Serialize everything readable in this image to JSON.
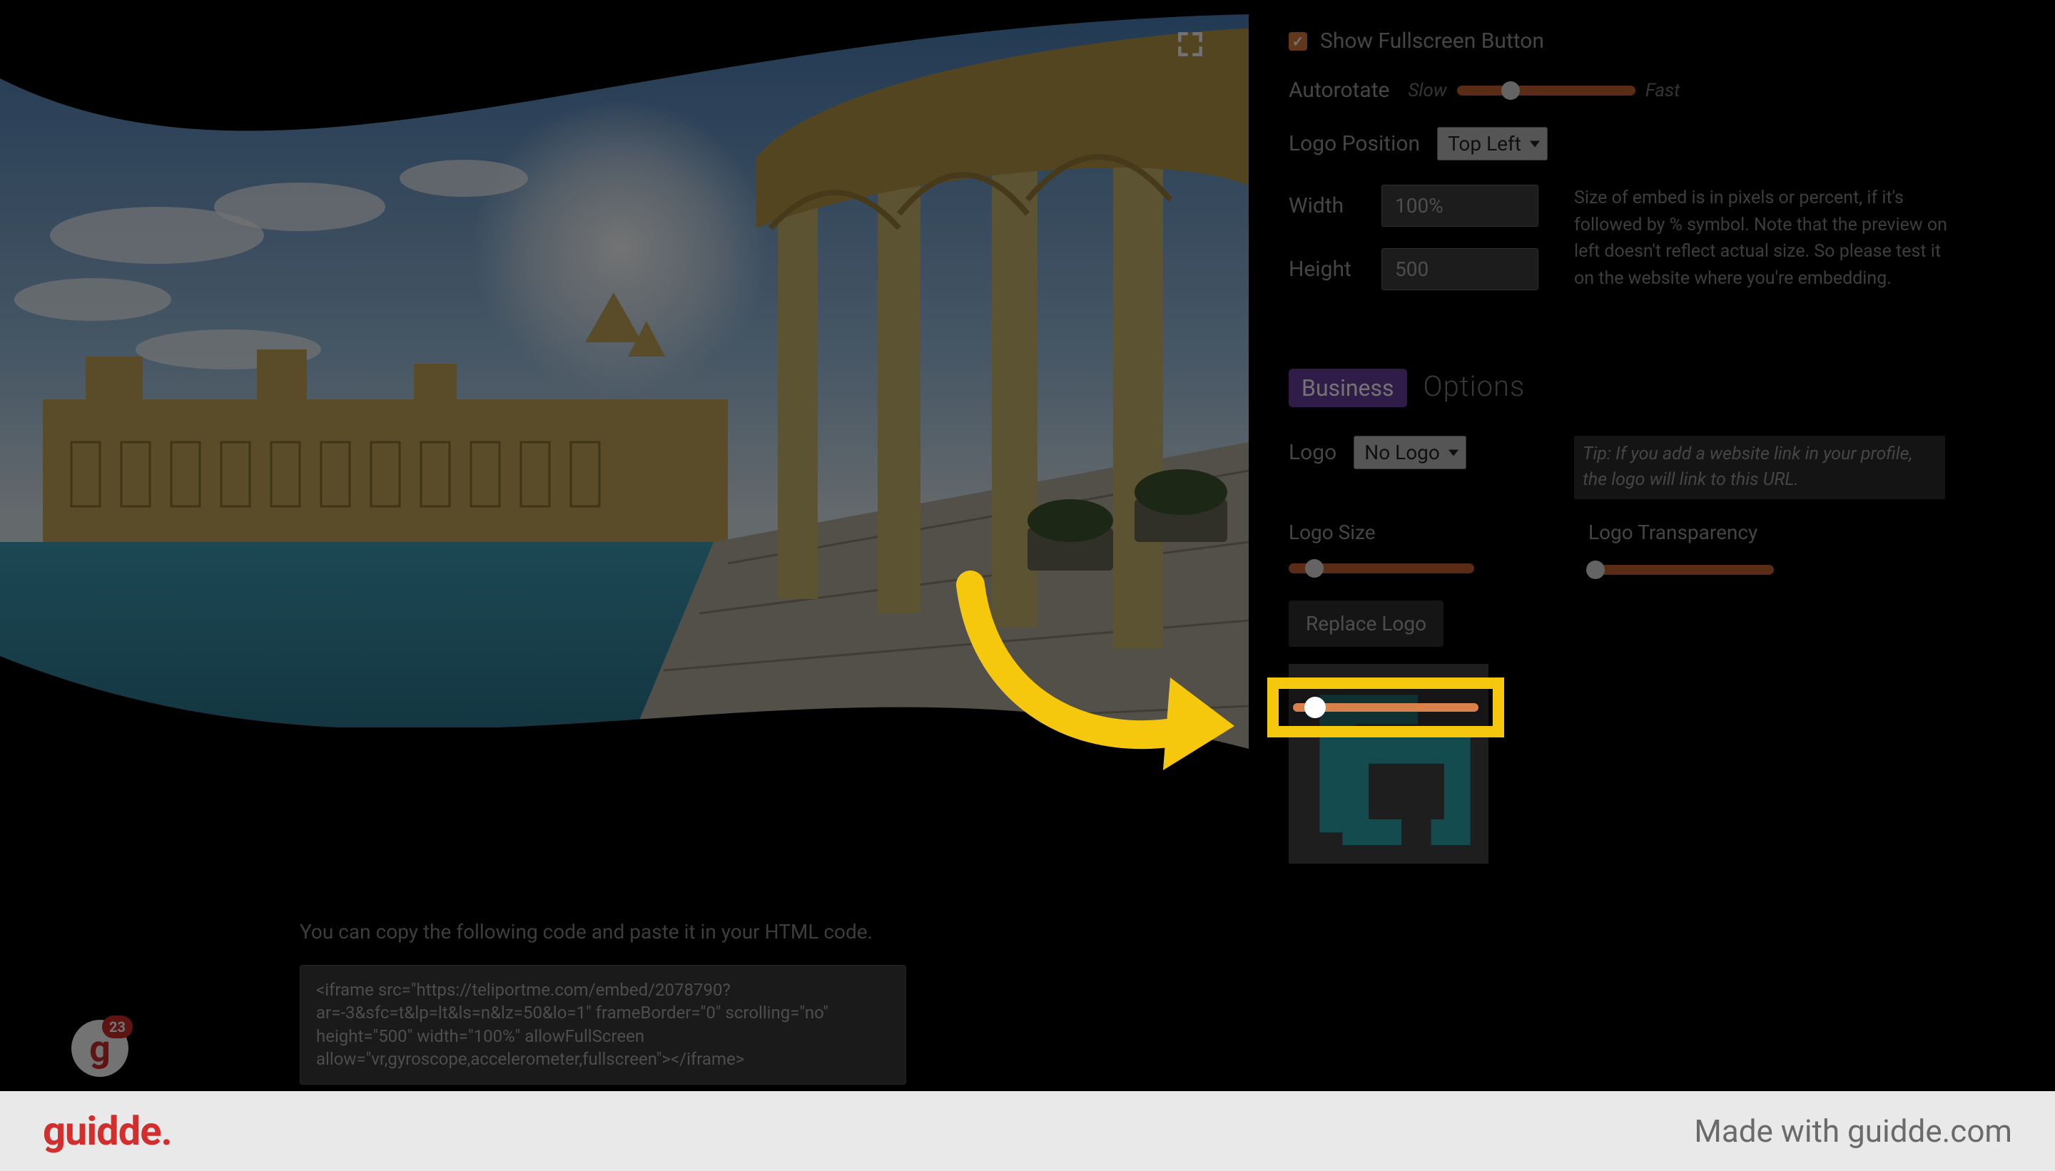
{
  "preview": {
    "fullscreen_icon_name": "fullscreen-icon"
  },
  "badge": {
    "count": "23"
  },
  "code": {
    "intro": "You can copy the following code and paste it in your HTML code.",
    "snippet": "<iframe src=\"https://teliportme.com/embed/2078790?ar=-3&sfc=t&lp=lt&ls=n&lz=50&lo=1\" frameBorder=\"0\" scrolling=\"no\" height=\"500\" width=\"100%\" allowFullScreen allow=\"vr,gyroscope,accelerometer,fullscreen\"></iframe>"
  },
  "sidebar": {
    "show_fullscreen_label": "Show Fullscreen Button",
    "autorotate": {
      "label": "Autorotate",
      "slow": "Slow",
      "fast": "Fast"
    },
    "logo_position": {
      "label": "Logo Position",
      "value": "Top Left"
    },
    "width": {
      "label": "Width",
      "value": "100%"
    },
    "height": {
      "label": "Height",
      "value": "500"
    },
    "size_desc": "Size of embed is in pixels or percent, if it's followed by % symbol. Note that the preview on left doesn't reflect actual size. So please test it on the website where you're embedding.",
    "business_badge": "Business",
    "options_heading": "Options",
    "logo": {
      "label": "Logo",
      "value": "No Logo"
    },
    "tip": "Tip: If you add a website link in your profile, the logo will link to this URL.",
    "logo_size_label": "Logo Size",
    "logo_transparency_label": "Logo Transparency",
    "replace_logo": "Replace Logo"
  },
  "footer": {
    "brand": "guidde.",
    "made_with": "Made with guidde.com"
  },
  "colors": {
    "accent": "#c8622f",
    "highlight": "#f5c80e",
    "business": "#6b3fa0",
    "brand_red": "#d22e2e",
    "logo_teal": "#2aa6ae"
  }
}
